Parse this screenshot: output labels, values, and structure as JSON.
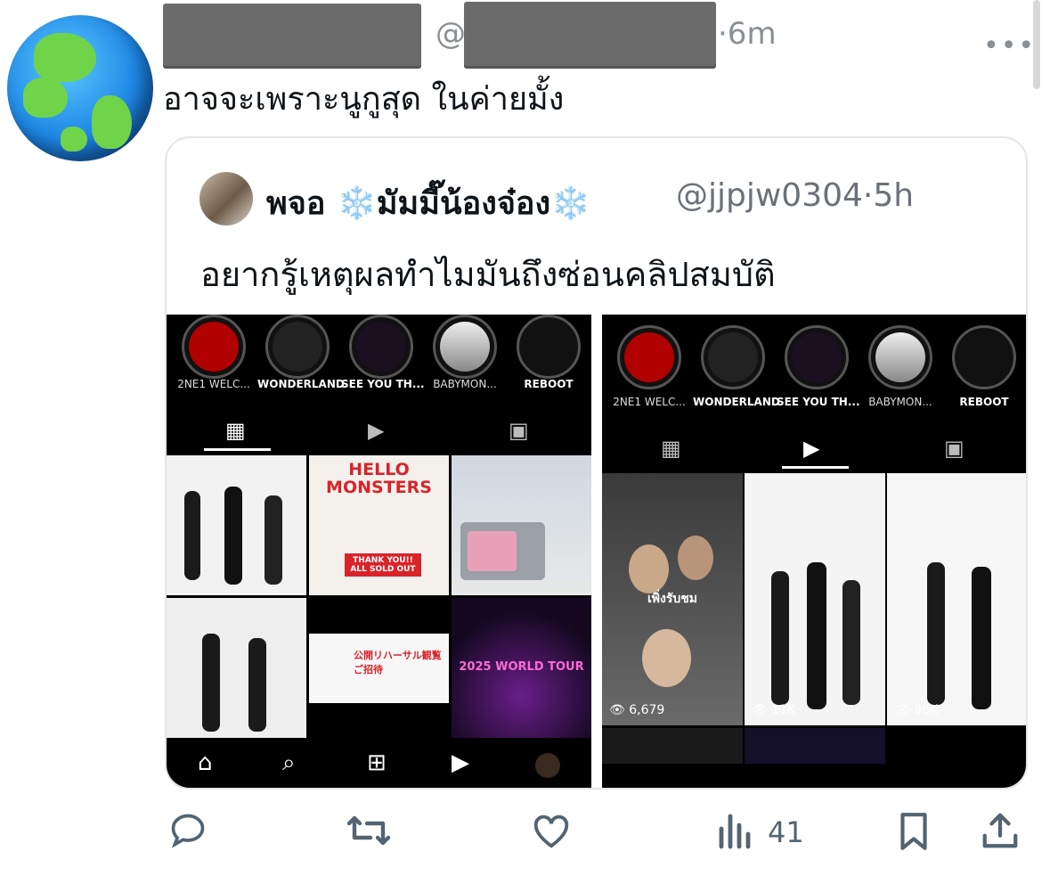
{
  "tweet": {
    "handle_prefix": "@",
    "time": "·6m",
    "text": "อาจจะเพราะนูกูสุด ในค่ายมั้ง",
    "more_icon": "more-horizontal-icon"
  },
  "quote": {
    "name_left": "พจอ",
    "name_right": "มัมมี๊น้องจ๋อง",
    "snowflake": "❄️",
    "handle": "@jjpjw0304",
    "time": "·5h",
    "text": "อยากรู้เหตุผลทำไมมันถึงซ่อนคลิปสมบัติ"
  },
  "left_shot": {
    "highlights": [
      "2NE1 WELC...",
      "WONDERLAND",
      "SEE YOU TH...",
      "BABYMON...",
      "REBOOT"
    ],
    "posts": [
      {
        "text": ""
      },
      {
        "text": "HELLO MONSTERS",
        "sub": "THANK YOU!! ALL SOLD OUT"
      },
      {
        "text": ""
      },
      {
        "text": ""
      },
      {
        "text": "公開リハーサル観覧 ご招待"
      },
      {
        "text": "2025 WORLD TOUR"
      }
    ]
  },
  "right_shot": {
    "highlights": [
      "2NE1 WELC...",
      "WONDERLAND",
      "SEE YOU TH...",
      "BABYMON...",
      "REBOOT"
    ],
    "reels": [
      {
        "overlay": "เพิ่งรับชม",
        "views": "6,679"
      },
      {
        "overlay": "",
        "views": "11K"
      },
      {
        "overlay": "",
        "views": "96K"
      }
    ]
  },
  "actions": {
    "reply_icon": "reply-icon",
    "retweet_icon": "retweet-icon",
    "like_icon": "heart-icon",
    "views_icon": "views-icon",
    "views": "41",
    "bookmark_icon": "bookmark-icon",
    "share_icon": "share-icon"
  }
}
